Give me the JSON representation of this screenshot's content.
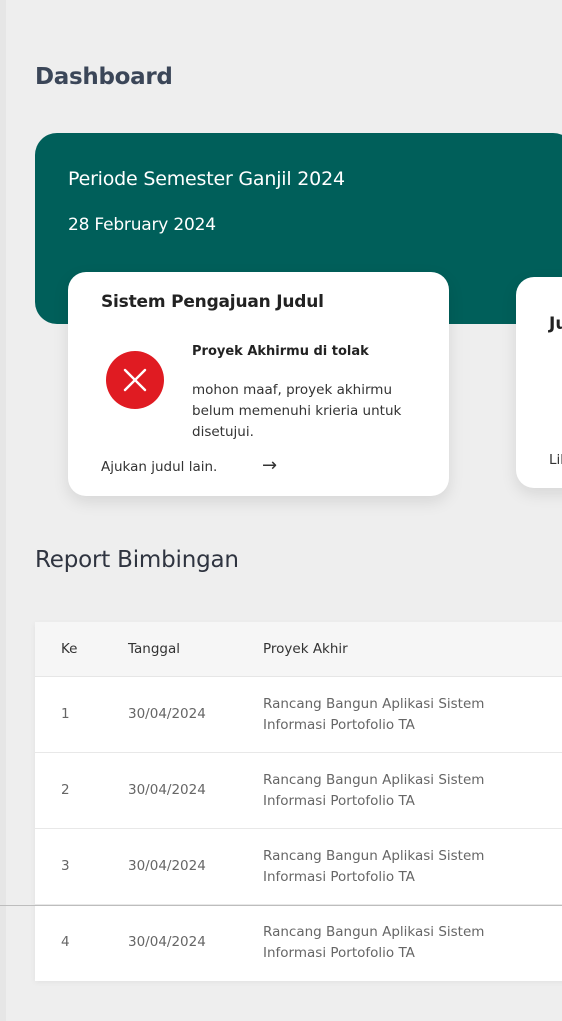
{
  "page": {
    "title": "Dashboard"
  },
  "banner": {
    "period": "Periode Semester Ganjil 2024",
    "date": "28 February 2024",
    "color": "#005f5a"
  },
  "cards": [
    {
      "title": "Sistem Pengajuan Judul",
      "icon": "close-circle-icon",
      "status_title": "Proyek Akhirmu di tolak",
      "status_desc": "mohon maaf, proyek akhirmu belum memenuhi krieria untuk disetujui.",
      "link_label": "Ajukan judul lain.",
      "link_arrow": "→",
      "status_color": "#e01b22"
    },
    {
      "title_partial": "Ju",
      "link_partial": "Lih"
    }
  ],
  "report": {
    "title": "Report Bimbingan",
    "columns": [
      "Ke",
      "Tanggal",
      "Proyek Akhir"
    ],
    "rows": [
      {
        "no": "1",
        "date": "30/04/2024",
        "project": "Rancang Bangun Aplikasi Sistem Informasi Portofolio TA"
      },
      {
        "no": "2",
        "date": "30/04/2024",
        "project": "Rancang Bangun Aplikasi Sistem Informasi Portofolio TA"
      },
      {
        "no": "3",
        "date": "30/04/2024",
        "project": "Rancang Bangun Aplikasi Sistem Informasi Portofolio TA"
      },
      {
        "no": "4",
        "date": "30/04/2024",
        "project": "Rancang Bangun Aplikasi Sistem Informasi Portofolio TA"
      }
    ]
  }
}
